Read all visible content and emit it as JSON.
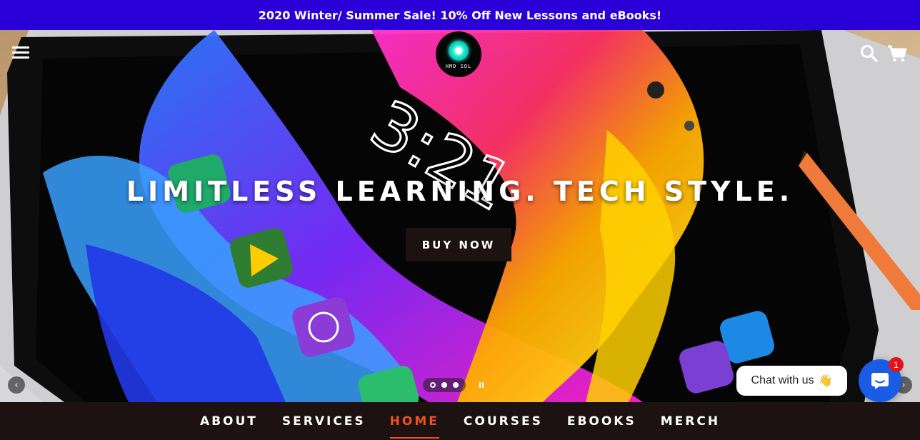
{
  "announcement": {
    "text": "2020 Winter/ Summer Sale! 10% Off New Lessons and eBooks!"
  },
  "header": {
    "logo_text": "HMD SOL",
    "menu_icon": "hamburger-menu-icon",
    "search_icon": "search-icon",
    "cart_icon": "cart-icon"
  },
  "hero": {
    "title": "LIMITLESS LEARNING. TECH STYLE.",
    "button_label": "BUY NOW",
    "slides": 3,
    "active_slide": 1,
    "prev_icon": "chevron-left-icon",
    "next_icon": "chevron-right-icon",
    "pause_icon": "pause-icon"
  },
  "chat": {
    "label": "Chat with us",
    "emoji": "👋",
    "badge_count": "1"
  },
  "nav": {
    "items": [
      {
        "label": "ABOUT"
      },
      {
        "label": "SERVICES"
      },
      {
        "label": "HOME"
      },
      {
        "label": "COURSES"
      },
      {
        "label": "EBOOKS"
      },
      {
        "label": "MERCH"
      }
    ],
    "active": "HOME"
  },
  "colors": {
    "announcement_bg": "#2a00d8",
    "nav_bg": "#1c1212",
    "nav_active": "#f0501e",
    "chat_blue": "#1a5ce6",
    "badge_red": "#e3131b"
  }
}
